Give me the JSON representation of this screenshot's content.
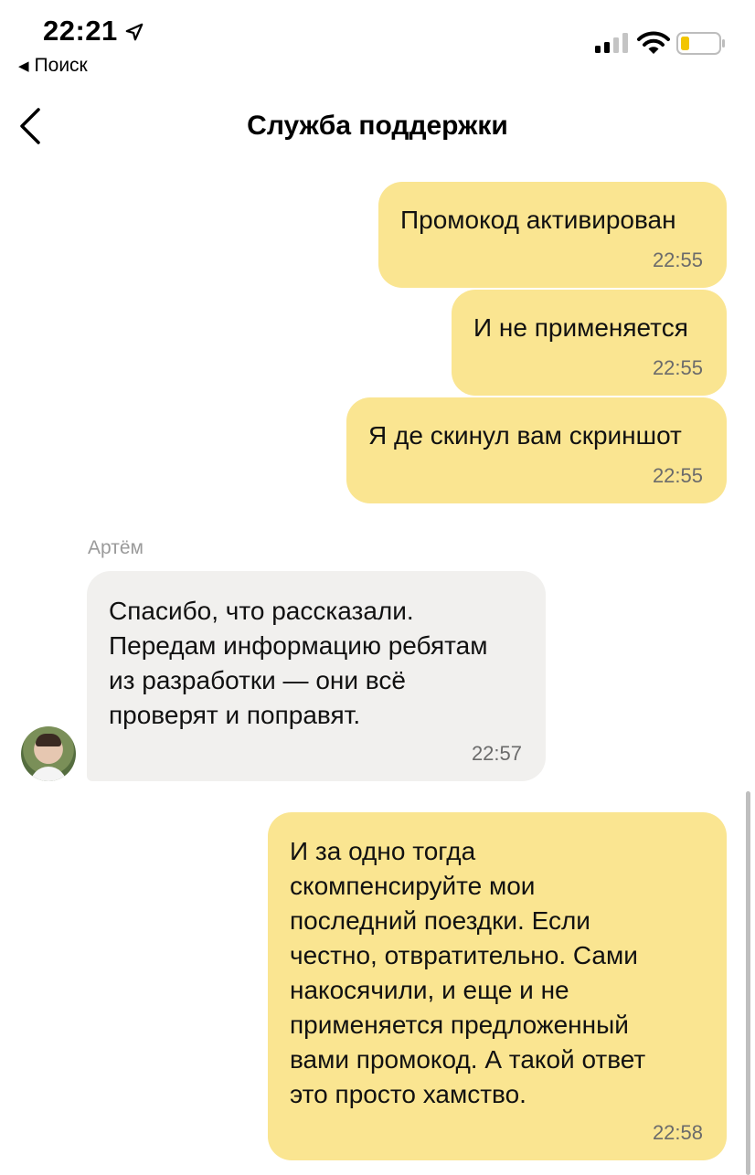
{
  "status_bar": {
    "time": "22:21",
    "back_app_label": "Поиск",
    "location_icon": "location-arrow-icon",
    "signal_icon": "cellular-signal-icon",
    "wifi_icon": "wifi-icon",
    "battery_icon": "battery-low-icon",
    "battery_color": "#f2c500"
  },
  "header": {
    "title": "Служба поддержки",
    "back_icon": "chevron-left-icon"
  },
  "colors": {
    "outgoing_bubble": "#fae591",
    "incoming_bubble": "#f1f0ee"
  },
  "messages": [
    {
      "direction": "outgoing",
      "text": "Промокод активирован",
      "time": "22:55"
    },
    {
      "direction": "outgoing",
      "text": "И не применяется",
      "time": "22:55"
    },
    {
      "direction": "outgoing",
      "text": "Я де скинул вам скриншот",
      "time": "22:55"
    },
    {
      "direction": "incoming",
      "author": "Артём",
      "lines": [
        "Спасибо, что рассказали.",
        "Передам информацию ребятам",
        "из разработки — они всё",
        "проверят и поправят."
      ],
      "time": "22:57"
    },
    {
      "direction": "outgoing",
      "lines": [
        "И за одно тогда",
        "скомпенсируйте мои",
        "последний поездки. Если",
        "честно, отвратительно. Сами",
        "накосячили, и еще и не",
        "применяется предложенный",
        "вами промокод. А такой ответ",
        "это просто хамство."
      ],
      "time": "22:58"
    }
  ]
}
